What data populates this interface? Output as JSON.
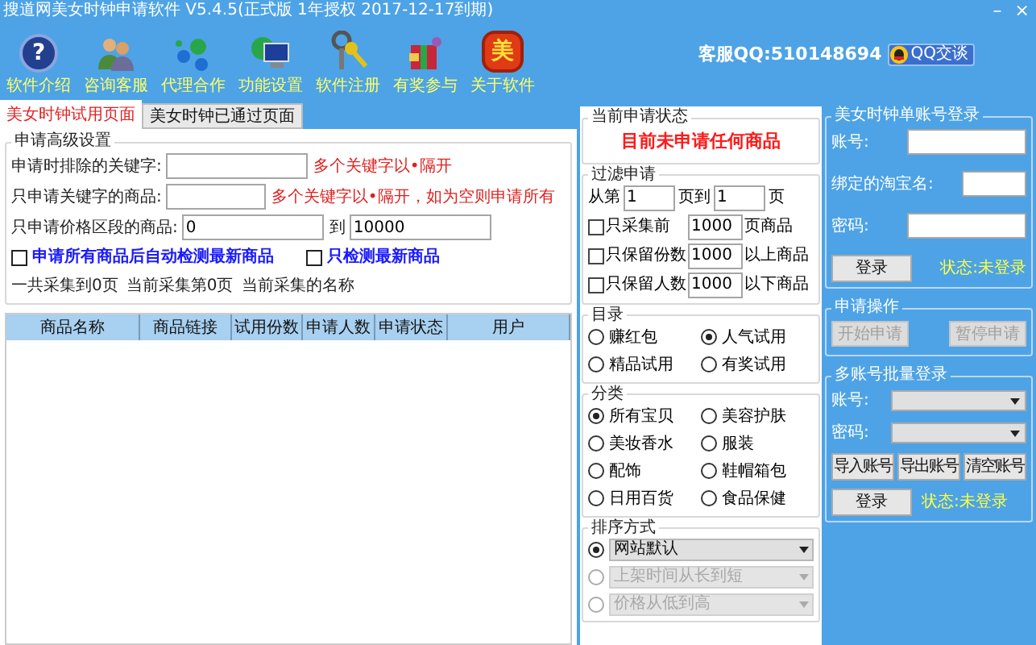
{
  "window": {
    "title": "搜道网美女时钟申请软件 V5.4.5(正式版 1年授权 2017-12-17到期)",
    "controls": [
      "–",
      "×"
    ]
  },
  "toolbar": [
    {
      "label": "软件介绍",
      "kind": "help",
      "glyph": "?"
    },
    {
      "label": "咨询客服",
      "kind": "people"
    },
    {
      "label": "代理合作",
      "kind": "network"
    },
    {
      "label": "功能设置",
      "kind": "monitor"
    },
    {
      "label": "软件注册",
      "kind": "keys"
    },
    {
      "label": "有奖参与",
      "kind": "gift"
    },
    {
      "label": "关于软件",
      "kind": "badge",
      "glyph": "美"
    }
  ],
  "contact": {
    "text": "客服QQ:510148694",
    "button": "QQ交谈"
  },
  "tabs": [
    {
      "label": "美女时钟试用页面",
      "selected": true
    },
    {
      "label": "美女时钟已通过页面",
      "selected": false
    }
  ],
  "advanced": {
    "title": "申请高级设置",
    "fields": [
      {
        "label": "申请时排除的关键字:",
        "note": "多个关键字以•隔开"
      },
      {
        "label": "只申请关键字的商品:",
        "note": "多个关键字以•隔开，如为空则申请所有"
      }
    ],
    "price": {
      "label": "只申请价格区段的商品:",
      "from": "0",
      "to_label": "到",
      "to": "10000"
    },
    "checks": [
      {
        "label": "申请所有商品后自动检测最新商品",
        "checked": false
      },
      {
        "label": "只检测最新商品",
        "checked": false
      }
    ],
    "progress": [
      "一共采集到0页",
      "当前采集第0页",
      "当前采集的名称"
    ]
  },
  "table": {
    "columns": [
      "商品名称",
      "商品链接",
      "试用份数",
      "申请人数",
      "申请状态",
      "用户"
    ]
  },
  "status": {
    "title": "当前申请状态",
    "message": "目前未申请任何商品"
  },
  "filter": {
    "title": "过滤申请",
    "from_label": "从第",
    "from": "1",
    "mid_label": "页到",
    "to": "1",
    "end_label": "页",
    "rows": [
      {
        "label": "只采集前",
        "checked": false,
        "value": "1000",
        "suffix": "页商品"
      },
      {
        "label": "只保留份数",
        "checked": false,
        "value": "1000",
        "suffix": "以上商品"
      },
      {
        "label": "只保留人数",
        "checked": false,
        "value": "1000",
        "suffix": "以下商品"
      }
    ]
  },
  "catalog": {
    "title": "目录",
    "options": [
      {
        "label": "赚红包",
        "selected": false
      },
      {
        "label": "人气试用",
        "selected": true
      },
      {
        "label": "精品试用",
        "selected": false
      },
      {
        "label": "有奖试用",
        "selected": false
      }
    ]
  },
  "category": {
    "title": "分类",
    "options": [
      {
        "label": "所有宝贝",
        "selected": true
      },
      {
        "label": "美容护肤",
        "selected": false
      },
      {
        "label": "美妆香水",
        "selected": false
      },
      {
        "label": "服装",
        "selected": false
      },
      {
        "label": "配饰",
        "selected": false
      },
      {
        "label": "鞋帽箱包",
        "selected": false
      },
      {
        "label": "日用百货",
        "selected": false
      },
      {
        "label": "食品保健",
        "selected": false
      }
    ]
  },
  "sort": {
    "title": "排序方式",
    "options": [
      {
        "value": "网站默认",
        "selected": true,
        "disabled": false
      },
      {
        "value": "上架时间从长到短",
        "selected": false,
        "disabled": true
      },
      {
        "value": "价格从低到高",
        "selected": false,
        "disabled": true
      }
    ]
  },
  "single_login": {
    "title": "美女时钟单账号登录",
    "fields": [
      {
        "label": "账号:"
      },
      {
        "label": "绑定的淘宝名:"
      },
      {
        "label": "密码:"
      }
    ],
    "button": "登录",
    "status": "状态:未登录"
  },
  "actions": {
    "title": "申请操作",
    "buttons": [
      {
        "label": "开始申请",
        "disabled": true
      },
      {
        "label": "暂停申请",
        "disabled": true
      }
    ]
  },
  "batch": {
    "title": "多账号批量登录",
    "selects": [
      {
        "label": "账号:"
      },
      {
        "label": "密码:"
      }
    ],
    "buttons": [
      "导入账号",
      "导出账号",
      "清空账号"
    ],
    "login": "登录",
    "status": "状态:未登录"
  }
}
